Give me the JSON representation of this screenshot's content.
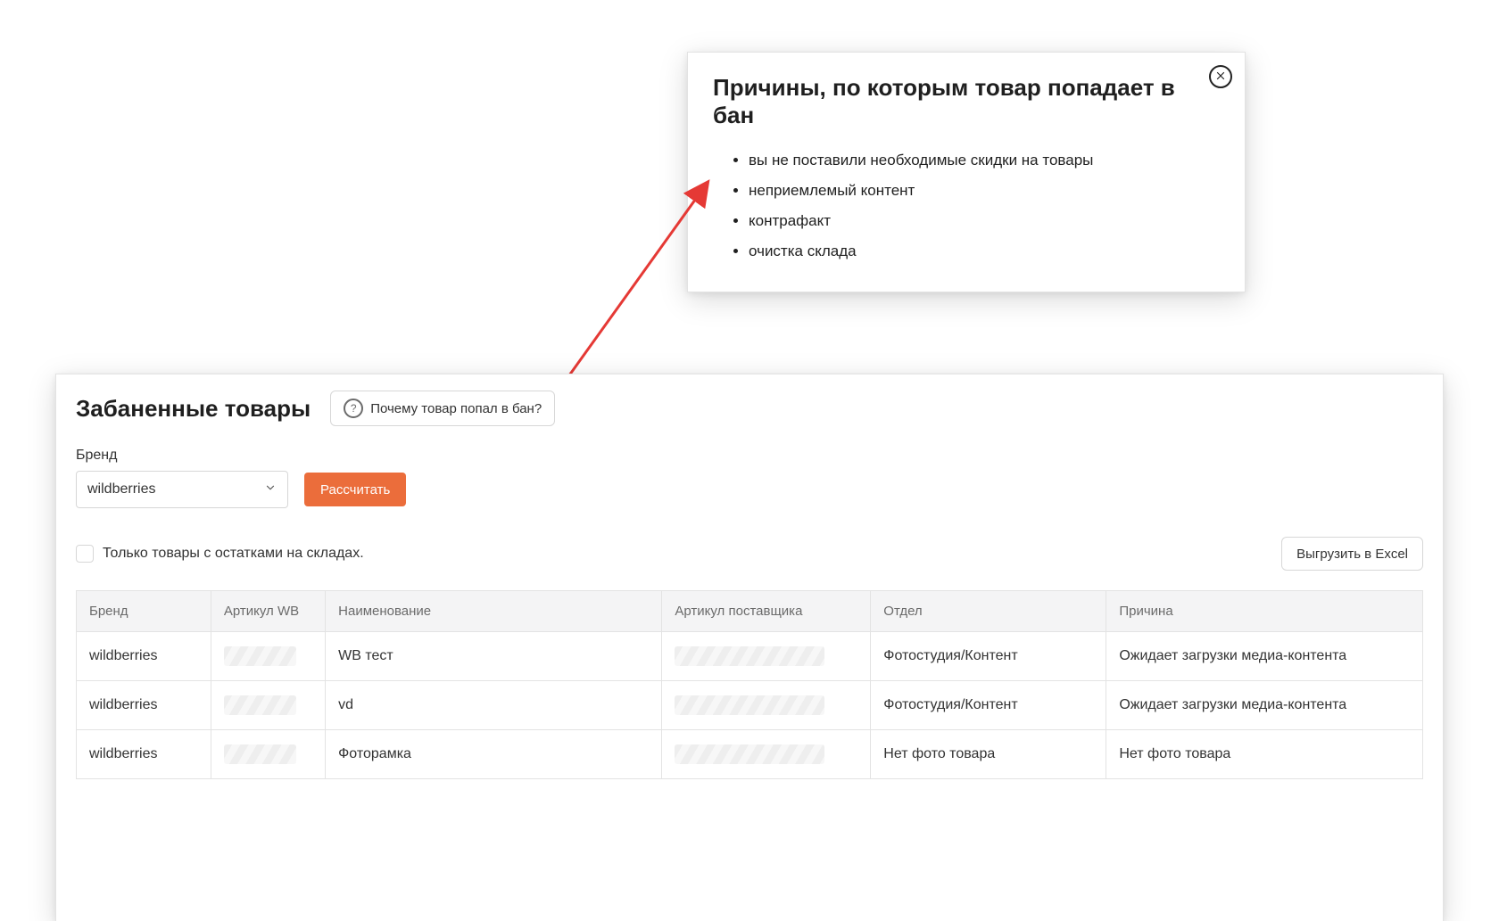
{
  "popover": {
    "title": "Причины, по которым товар попадает в бан",
    "items": [
      "вы не поставили необходимые скидки на товары",
      "неприемлемый контент",
      "контрафакт",
      "очистка склада"
    ]
  },
  "page": {
    "title": "Забаненные товары",
    "why_label": "Почему товар попал в бан?",
    "brand_label": "Бренд",
    "brand_value": "wildberries",
    "calc_label": "Рассчитать",
    "only_stock_label": "Только товары с остатками на складах.",
    "export_label": "Выгрузить в Excel"
  },
  "table": {
    "headers": {
      "brand": "Бренд",
      "article_wb": "Артикул WB",
      "name": "Наименование",
      "supplier_article": "Артикул поставщика",
      "department": "Отдел",
      "reason": "Причина"
    },
    "rows": [
      {
        "brand": "wildberries",
        "article_wb": "",
        "name": "WB тест",
        "supplier_article": "",
        "department": "Фотостудия/Контент",
        "reason": "Ожидает загрузки медиа-контента"
      },
      {
        "brand": "wildberries",
        "article_wb": "",
        "name": "vd",
        "supplier_article": "",
        "department": "Фотостудия/Контент",
        "reason": "Ожидает загрузки медиа-контента"
      },
      {
        "brand": "wildberries",
        "article_wb": "",
        "name": "Фоторамка",
        "supplier_article": "",
        "department": "Нет фото товара",
        "reason": "Нет фото товара"
      }
    ]
  },
  "colors": {
    "accent_orange": "#eb6d3b",
    "accent_red": "#e53935"
  }
}
